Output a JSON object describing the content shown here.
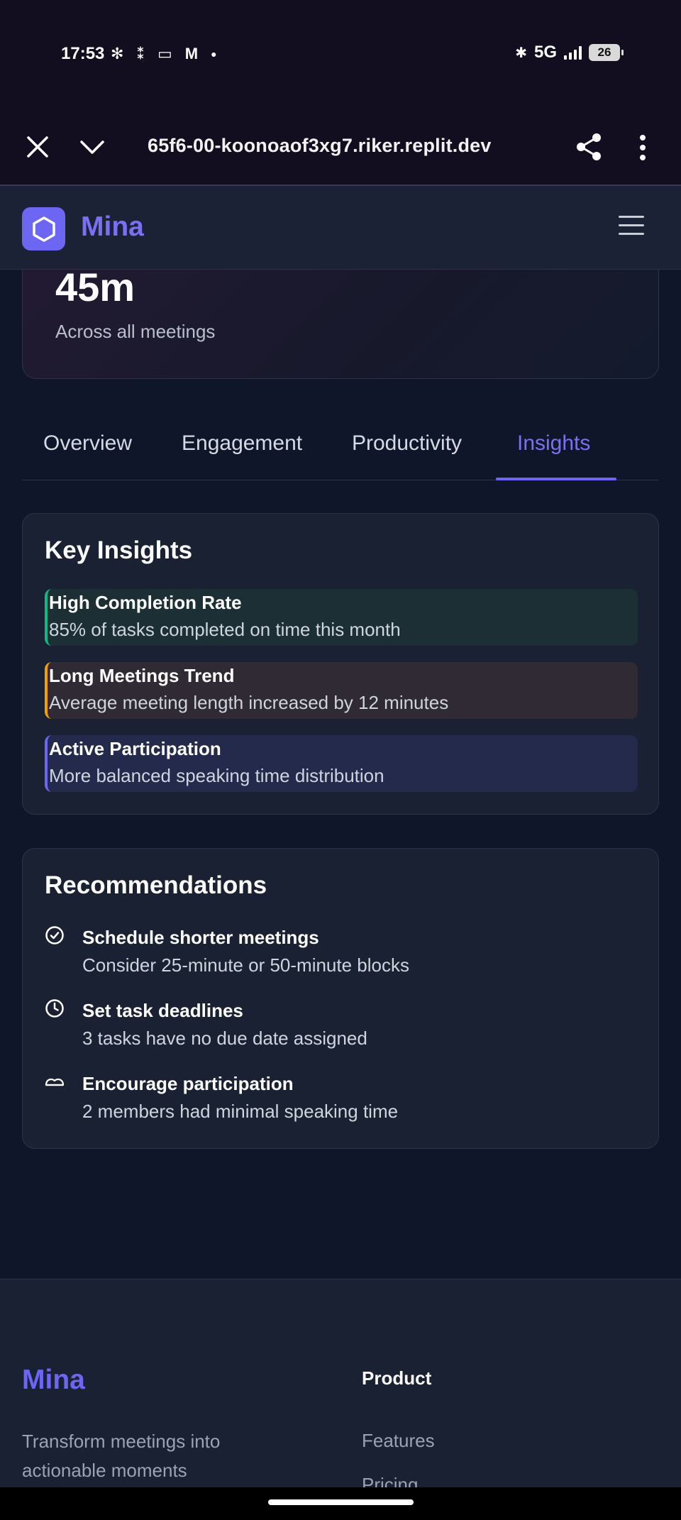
{
  "status_bar": {
    "time": "17:53",
    "network": "5G",
    "battery": "26",
    "left_icons": [
      "slack-icon",
      "grid-icon",
      "wallet-icon",
      "gmail-icon",
      "dot-icon"
    ],
    "right_icons": [
      "bluetooth-icon",
      "signal-icon",
      "battery-icon"
    ]
  },
  "browser": {
    "url": "65f6-00-koonoaof3xg7.riker.replit.dev",
    "close_icon": "close-icon",
    "tabs_icon": "chevron-down-icon",
    "share_icon": "share-icon",
    "more_icon": "more-vertical-icon"
  },
  "header": {
    "app_name": "Mina",
    "logo_icon": "hexagon-logo-icon",
    "menu_icon": "hamburger-menu-icon"
  },
  "stat_card": {
    "value": "45m",
    "caption": "Across all meetings"
  },
  "tabs": {
    "items": [
      {
        "label": "Overview"
      },
      {
        "label": "Engagement"
      },
      {
        "label": "Productivity"
      },
      {
        "label": "Insights"
      }
    ],
    "active": "Insights"
  },
  "key_insights": {
    "title": "Key Insights",
    "items": [
      {
        "title": "High Completion Rate",
        "description": "85% of tasks completed on time this month",
        "accent": "#10b981",
        "background": "#1b2f35"
      },
      {
        "title": "Long Meetings Trend",
        "description": "Average meeting length increased by 12 minutes",
        "accent": "#f59e0b",
        "background": "#2f2a33"
      },
      {
        "title": "Active Participation",
        "description": "More balanced speaking time distribution",
        "accent": "#6d66f2",
        "background": "#232a4b"
      }
    ]
  },
  "recommendations": {
    "title": "Recommendations",
    "items": [
      {
        "icon": "check-circle-icon",
        "title": "Schedule shorter meetings",
        "description": "Consider 25-minute or 50-minute blocks"
      },
      {
        "icon": "clock-icon",
        "title": "Set task deadlines",
        "description": "3 tasks have no due date assigned"
      },
      {
        "icon": "users-icon",
        "title": "Encourage participation",
        "description": "2 members had minimal speaking time"
      }
    ]
  },
  "footer": {
    "brand": "Mina",
    "tagline": "Transform meetings into actionable moments",
    "product_heading": "Product",
    "product_links": [
      "Features",
      "Pricing"
    ]
  },
  "colors": {
    "accent": "#6d66f2",
    "background": "#0f1629",
    "card": "#1a2133"
  }
}
